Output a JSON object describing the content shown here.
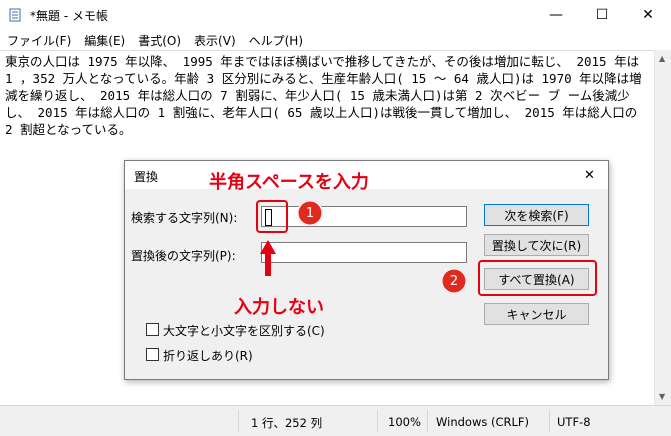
{
  "window": {
    "title": "*無題 - メモ帳",
    "minimize_glyph": "—",
    "maximize_glyph": "☐",
    "close_glyph": "✕"
  },
  "menu": {
    "items": [
      {
        "label": "ファイル(F)"
      },
      {
        "label": "編集(E)"
      },
      {
        "label": "書式(O)"
      },
      {
        "label": "表示(V)"
      },
      {
        "label": "ヘルプ(H)"
      }
    ]
  },
  "editor": {
    "text": "東京の人口は 1975 年以降、 1995 年まではほぼ横ばいで推移してきたが、その後は増加に転じ、 2015 年は 1 ，352 万人となっている。年齢 3 区分別にみると、生産年齢人口( 15 ～ 64 歳人口)は 1970 年以降は増減を繰り返し、 2015 年は総人口の 7 割弱に、年少人口( 15 歳未満人口)は第 2 次ベビー ブ ーム後減少し、 2015 年は総人口の 1 割強に、老年人口( 65 歳以上人口)は戦後一貫して増加し、 2015 年は総人口の 2 割超となっている。"
  },
  "status": {
    "position": "1 行、252 列",
    "zoom": "100%",
    "line_ending": "Windows (CRLF)",
    "encoding": "UTF-8"
  },
  "dialog": {
    "title": "置換",
    "close_glyph": "✕",
    "find_label": "検索する文字列(N):",
    "find_value": "",
    "replace_label": "置換後の文字列(P):",
    "replace_value": "",
    "find_next_button": "次を検索(F)",
    "replace_next_button": "置換して次に(R)",
    "replace_all_button": "すべて置換(A)",
    "cancel_button": "キャンセル",
    "match_case_label": "大文字と小文字を区別する(C)",
    "wrap_label": "折り返しあり(R)"
  },
  "annotations": {
    "top_note": "半角スペースを入力",
    "bottom_note": "入力しない",
    "step1": "1",
    "step2": "2",
    "color": "#e60012"
  }
}
